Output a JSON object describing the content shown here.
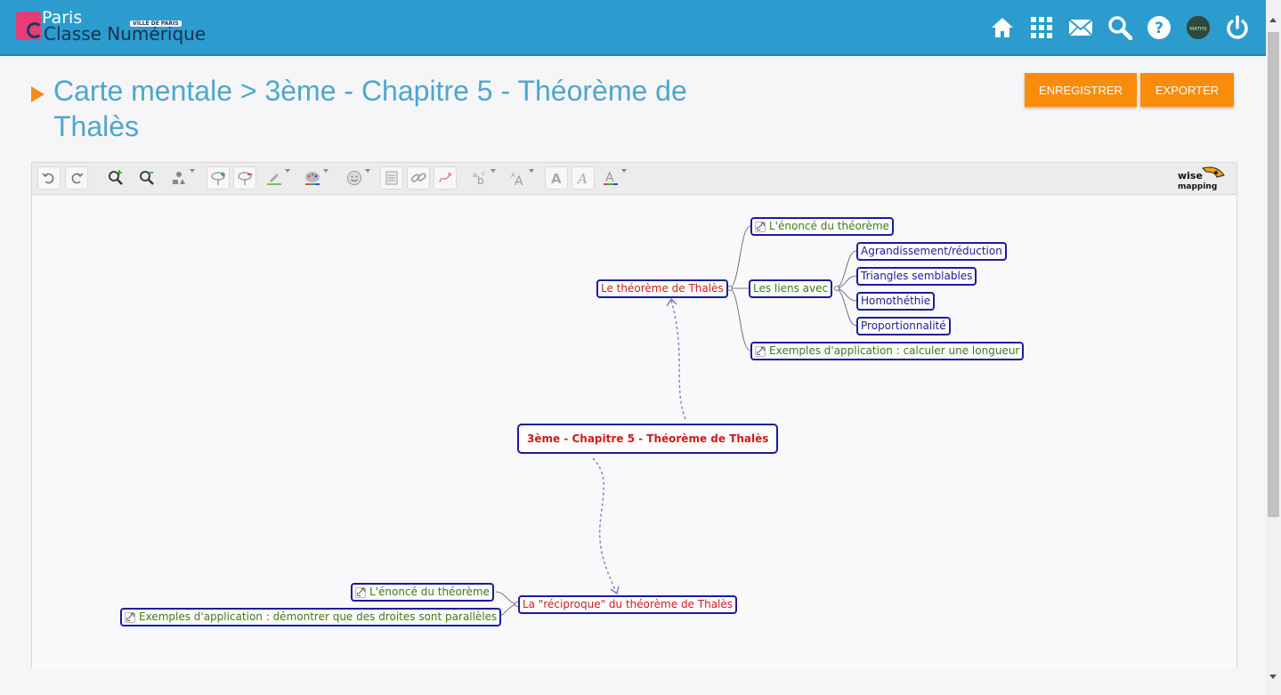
{
  "header": {
    "logo_line1": "Paris",
    "logo_line2": "Classe Numérique",
    "logo_badge": "VILLE DE PARIS",
    "icons": [
      "home-icon",
      "apps-grid-icon",
      "mail-icon",
      "search-icon",
      "help-icon",
      "avatar",
      "power-icon"
    ],
    "avatar_text": "MATHS"
  },
  "page": {
    "title": "Carte mentale > 3ème - Chapitre 5 - Théorème de Thalès",
    "save_label": "ENREGISTRER",
    "export_label": "EXPORTER"
  },
  "toolbar": {
    "buttons": [
      "undo",
      "redo",
      "zoom-in",
      "zoom-out",
      "topic-shape",
      "add-topic",
      "delete-topic",
      "border-color",
      "background-color",
      "icon",
      "note",
      "link",
      "relationship",
      "font-size",
      "font-family",
      "bold",
      "italic",
      "font-color"
    ],
    "brand": "wise mapping"
  },
  "mindmap": {
    "central": "3ème - Chapitre 5 - Théorème de Thalès",
    "branch1": {
      "label": "Le théorème de Thalès",
      "enonce": "L'énoncé du théorème",
      "liens": "Les liens avec",
      "liens_children": [
        "Agrandissement/réduction",
        "Triangles semblables",
        "Homothéthie",
        "Proportionnalité"
      ],
      "exemples": "Exemples d'application : calculer une longueur"
    },
    "branch2": {
      "label": "La \"réciproque\" du théorème de Thalès",
      "enonce": "L'énoncé du théorème",
      "exemples": "Exemples d'application : démontrer que des droites sont parallèles"
    },
    "colors": {
      "red_text": "#c91c1c",
      "blue_text": "#1b1b9a",
      "green_text": "#3b7a15",
      "border": "#1b1ba0",
      "relation": "#8f6bd4"
    }
  }
}
